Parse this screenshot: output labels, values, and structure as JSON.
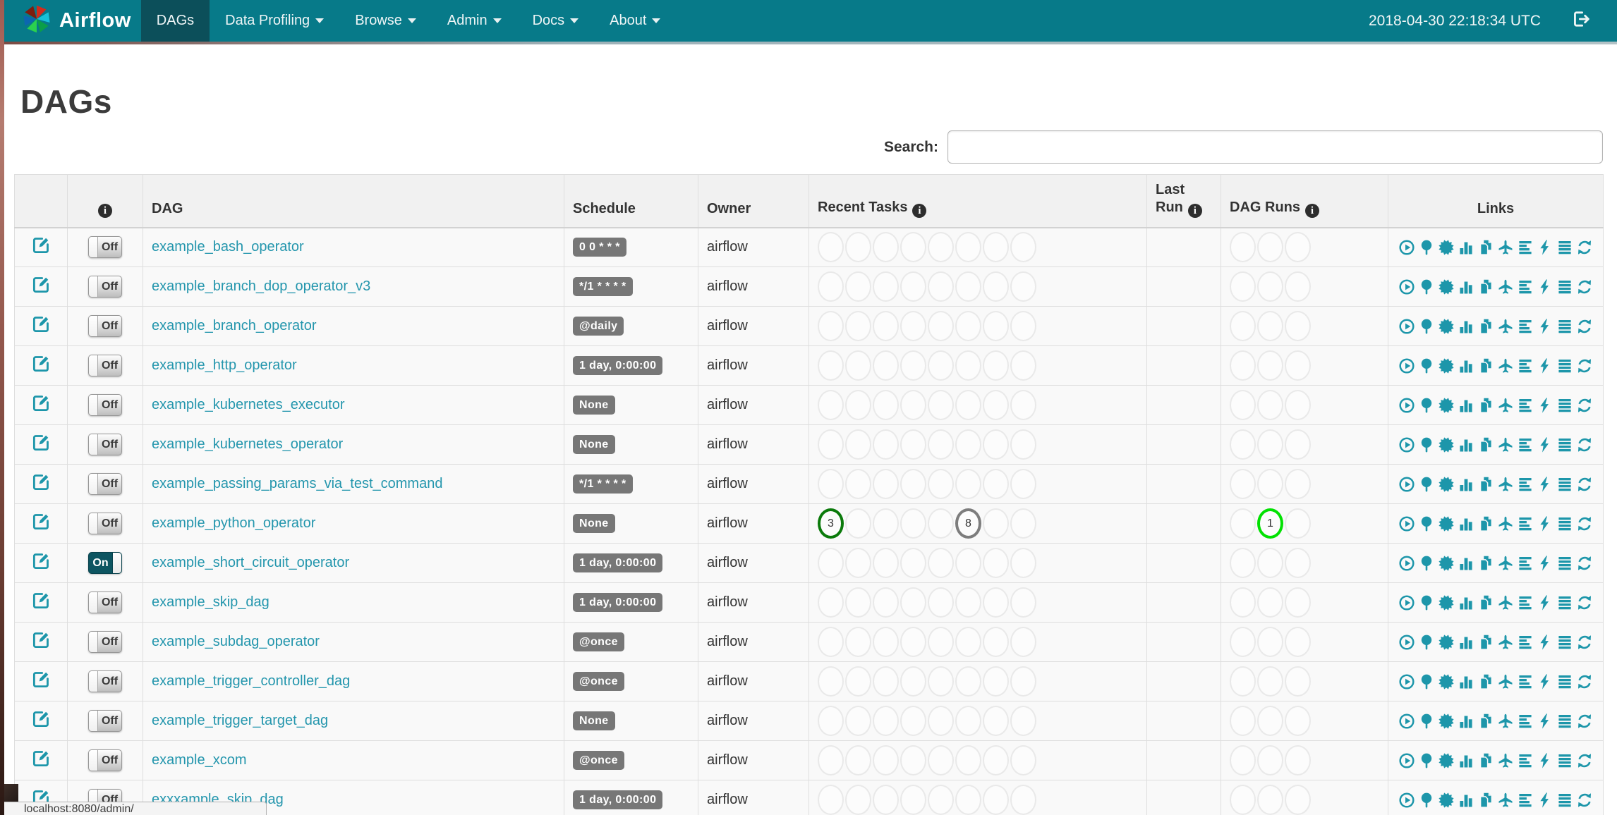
{
  "colors": {
    "navbar": "#077a89",
    "navbar_active": "#0c4f5a",
    "icon": "#1d96aa",
    "link": "#2496ad",
    "badge_bg": "#777777",
    "circle_empty": "#e9e9e9",
    "state_success": "#0b7a0b",
    "state_queued_gray": "#7d7d7d",
    "state_running": "#02e102"
  },
  "navbar": {
    "brand": "Airflow",
    "items": [
      {
        "label": "DAGs",
        "active": true,
        "caret": false
      },
      {
        "label": "Data Profiling",
        "active": false,
        "caret": true
      },
      {
        "label": "Browse",
        "active": false,
        "caret": true
      },
      {
        "label": "Admin",
        "active": false,
        "caret": true
      },
      {
        "label": "Docs",
        "active": false,
        "caret": true
      },
      {
        "label": "About",
        "active": false,
        "caret": true
      }
    ],
    "clock": "2018-04-30 22:18:34 UTC"
  },
  "page": {
    "title": "DAGs",
    "search_label": "Search:",
    "search_value": ""
  },
  "table": {
    "headers": {
      "dag": "DAG",
      "schedule": "Schedule",
      "owner": "Owner",
      "recent_tasks": "Recent Tasks",
      "last_run_line1": "Last",
      "last_run_line2": "Run",
      "dag_runs": "DAG Runs",
      "links": "Links"
    },
    "recent_slots": 8,
    "run_slots": 3,
    "link_icons": [
      "play-circle",
      "tree",
      "graph",
      "duration",
      "tries",
      "landing-times",
      "gantt",
      "bolt",
      "details",
      "refresh"
    ],
    "rows": [
      {
        "name": "example_bash_operator",
        "toggle": "Off",
        "schedule": "0 0 * * *",
        "owner": "airflow",
        "last_run": "",
        "recent_tasks": {},
        "dag_runs": {}
      },
      {
        "name": "example_branch_dop_operator_v3",
        "toggle": "Off",
        "schedule": "*/1 * * * *",
        "owner": "airflow",
        "last_run": "",
        "recent_tasks": {},
        "dag_runs": {}
      },
      {
        "name": "example_branch_operator",
        "toggle": "Off",
        "schedule": "@daily",
        "owner": "airflow",
        "last_run": "",
        "recent_tasks": {},
        "dag_runs": {}
      },
      {
        "name": "example_http_operator",
        "toggle": "Off",
        "schedule": "1 day, 0:00:00",
        "owner": "airflow",
        "last_run": "",
        "recent_tasks": {},
        "dag_runs": {}
      },
      {
        "name": "example_kubernetes_executor",
        "toggle": "Off",
        "schedule": "None",
        "owner": "airflow",
        "last_run": "",
        "recent_tasks": {},
        "dag_runs": {}
      },
      {
        "name": "example_kubernetes_operator",
        "toggle": "Off",
        "schedule": "None",
        "owner": "airflow",
        "last_run": "",
        "recent_tasks": {},
        "dag_runs": {}
      },
      {
        "name": "example_passing_params_via_test_command",
        "toggle": "Off",
        "schedule": "*/1 * * * *",
        "owner": "airflow",
        "last_run": "",
        "recent_tasks": {},
        "dag_runs": {}
      },
      {
        "name": "example_python_operator",
        "toggle": "Off",
        "schedule": "None",
        "owner": "airflow",
        "last_run": "",
        "recent_tasks": {
          "0": {
            "count": 3,
            "color": "#0b7a0b"
          },
          "5": {
            "count": 8,
            "color": "#7d7d7d"
          }
        },
        "dag_runs": {
          "1": {
            "count": 1,
            "color": "#02e102"
          }
        }
      },
      {
        "name": "example_short_circuit_operator",
        "toggle": "On",
        "schedule": "1 day, 0:00:00",
        "owner": "airflow",
        "last_run": "",
        "recent_tasks": {},
        "dag_runs": {}
      },
      {
        "name": "example_skip_dag",
        "toggle": "Off",
        "schedule": "1 day, 0:00:00",
        "owner": "airflow",
        "last_run": "",
        "recent_tasks": {},
        "dag_runs": {}
      },
      {
        "name": "example_subdag_operator",
        "toggle": "Off",
        "schedule": "@once",
        "owner": "airflow",
        "last_run": "",
        "recent_tasks": {},
        "dag_runs": {}
      },
      {
        "name": "example_trigger_controller_dag",
        "toggle": "Off",
        "schedule": "@once",
        "owner": "airflow",
        "last_run": "",
        "recent_tasks": {},
        "dag_runs": {}
      },
      {
        "name": "example_trigger_target_dag",
        "toggle": "Off",
        "schedule": "None",
        "owner": "airflow",
        "last_run": "",
        "recent_tasks": {},
        "dag_runs": {}
      },
      {
        "name": "example_xcom",
        "toggle": "Off",
        "schedule": "@once",
        "owner": "airflow",
        "last_run": "",
        "recent_tasks": {},
        "dag_runs": {}
      },
      {
        "name": "exxxample_skip_dag",
        "toggle": "Off",
        "schedule": "1 day, 0:00:00",
        "owner": "airflow",
        "last_run": "",
        "recent_tasks": {},
        "dag_runs": {}
      }
    ]
  },
  "status_bar": {
    "url": "localhost:8080/admin/"
  }
}
